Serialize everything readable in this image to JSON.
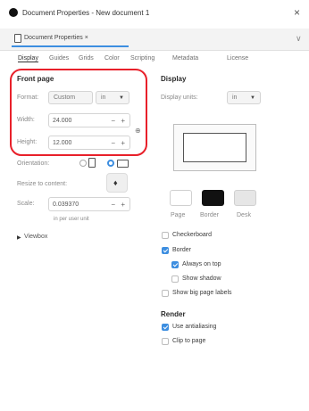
{
  "window": {
    "title": "Document Properties - New document 1",
    "close_glyph": "×"
  },
  "doc_tab": {
    "label": "Document Properties ×",
    "chevron": "∨"
  },
  "tabs": [
    "Display",
    "Guides",
    "Grids",
    "Color",
    "Scripting",
    "Metadata",
    "License"
  ],
  "front_page": {
    "heading": "Front page",
    "format_label": "Format:",
    "format_value": "Custom",
    "format_unit": "in",
    "width_label": "Width:",
    "width_value": "24.000",
    "height_label": "Height:",
    "height_value": "12.000",
    "stepper": "− +",
    "link_glyph": "⊕",
    "orientation_label": "Orientation:",
    "resize_label": "Resize to content:",
    "scale_label": "Scale:",
    "scale_value": "0.039370",
    "scale_note": "in per user unit",
    "viewbox_label": "Viewbox"
  },
  "display": {
    "heading": "Display",
    "units_label": "Display units:",
    "units_value": "in",
    "swatches": [
      "Page",
      "Border",
      "Desk"
    ],
    "checks": {
      "checkerboard": "Checkerboard",
      "border": "Border",
      "always_on_top": "Always on top",
      "show_shadow": "Show shadow",
      "big_labels": "Show big page labels"
    }
  },
  "render": {
    "heading": "Render",
    "antialiasing": "Use antialiasing",
    "clip": "Clip to page"
  },
  "colors": {
    "accent": "#3d8ee0",
    "highlight": "#e8202a"
  }
}
